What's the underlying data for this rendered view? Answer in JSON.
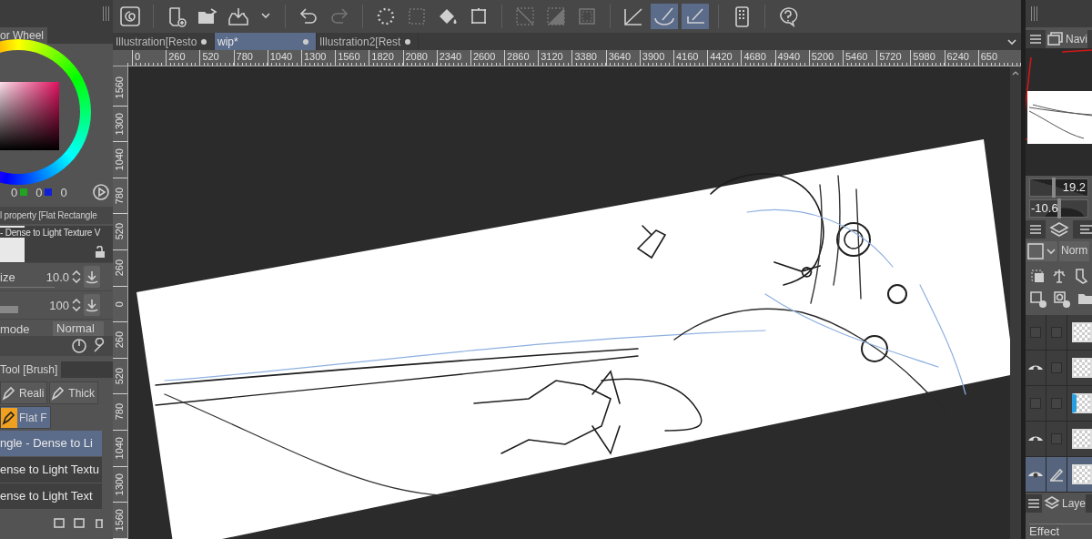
{
  "left_panel": {
    "color_wheel": {
      "tab": "or Wheel",
      "channels": [
        {
          "value": "0",
          "color": "#1fa51f"
        },
        {
          "value": "0",
          "color": "#1020d8"
        },
        {
          "value": "0"
        }
      ]
    },
    "tool_property": {
      "title": "l property [Flat Rectangle",
      "brush_name": "- Dense to Light Texture V",
      "size": {
        "label": "ize",
        "value": "10.0"
      },
      "opacity": {
        "value": "100",
        "level": 1
      },
      "blend": {
        "label": "mode",
        "value": "Normal"
      }
    },
    "sub_tool": {
      "tab": "Tool [Brush]",
      "groups": [
        {
          "label": "Reali",
          "selected": false
        },
        {
          "label": "Thick",
          "selected": false
        },
        {
          "label": "Flat F",
          "selected": true
        }
      ],
      "brushes": [
        {
          "name": "ngle - Dense to Li",
          "selected": true
        },
        {
          "name": "ense to Light Textu",
          "selected": false
        },
        {
          "name": "ense to Light Text",
          "selected": false
        }
      ]
    }
  },
  "toolbar": {
    "groups": [
      [
        {
          "kind": "logo"
        }
      ],
      [
        {
          "kind": "new"
        },
        {
          "kind": "open"
        },
        {
          "kind": "export"
        },
        {
          "kind": "caret"
        }
      ],
      [
        {
          "kind": "undo"
        },
        {
          "kind": "redo",
          "disabled": true
        }
      ],
      [
        {
          "kind": "select-all"
        },
        {
          "kind": "deselect",
          "disabled": true
        },
        {
          "kind": "fill"
        },
        {
          "kind": "transform"
        }
      ],
      [
        {
          "kind": "ruler-off",
          "disabled": true
        },
        {
          "kind": "ruler-fill",
          "disabled": true
        },
        {
          "kind": "frame",
          "disabled": true
        }
      ],
      [
        {
          "kind": "ruler",
          "selected": false
        },
        {
          "kind": "pen-curve",
          "selected": true
        },
        {
          "kind": "pen-line",
          "selected": true
        }
      ],
      [
        {
          "kind": "device"
        }
      ],
      [
        {
          "kind": "help"
        }
      ]
    ]
  },
  "document_tabs": [
    {
      "label": "Illustration[Resto",
      "selected": false
    },
    {
      "label": "wip*",
      "selected": true
    },
    {
      "label": "Illustration2[Rest",
      "selected": false
    }
  ],
  "ruler_horizontal": [
    "0",
    "260",
    "520",
    "780",
    "1040",
    "1300",
    "1560",
    "1820",
    "2080",
    "2340",
    "2600",
    "2860",
    "3120",
    "3380",
    "3640",
    "3900",
    "4160",
    "4420",
    "4680",
    "4940",
    "5200",
    "5460",
    "5720",
    "5980",
    "6240",
    "650"
  ],
  "ruler_vertical": [
    "1560",
    "1300",
    "1040",
    "780",
    "520",
    "260",
    "0",
    "260",
    "520",
    "780",
    "1040",
    "1300",
    "1560"
  ],
  "right_panel": {
    "navigator_tab": "Navi",
    "zoom": {
      "value": "19.2",
      "level": 0.42
    },
    "rotation": {
      "value": "-10.6",
      "level": 0.5
    },
    "blend_mode": "Norm",
    "layers": [
      {
        "visible": false,
        "selected": false,
        "marked": false
      },
      {
        "visible": true,
        "selected": false,
        "marked": false
      },
      {
        "visible": false,
        "selected": false,
        "marked": true
      },
      {
        "visible": true,
        "selected": false,
        "marked": false
      },
      {
        "visible": true,
        "selected": true,
        "marked": false
      }
    ],
    "layer_tab": "Laye",
    "effect_label": "Effect"
  }
}
